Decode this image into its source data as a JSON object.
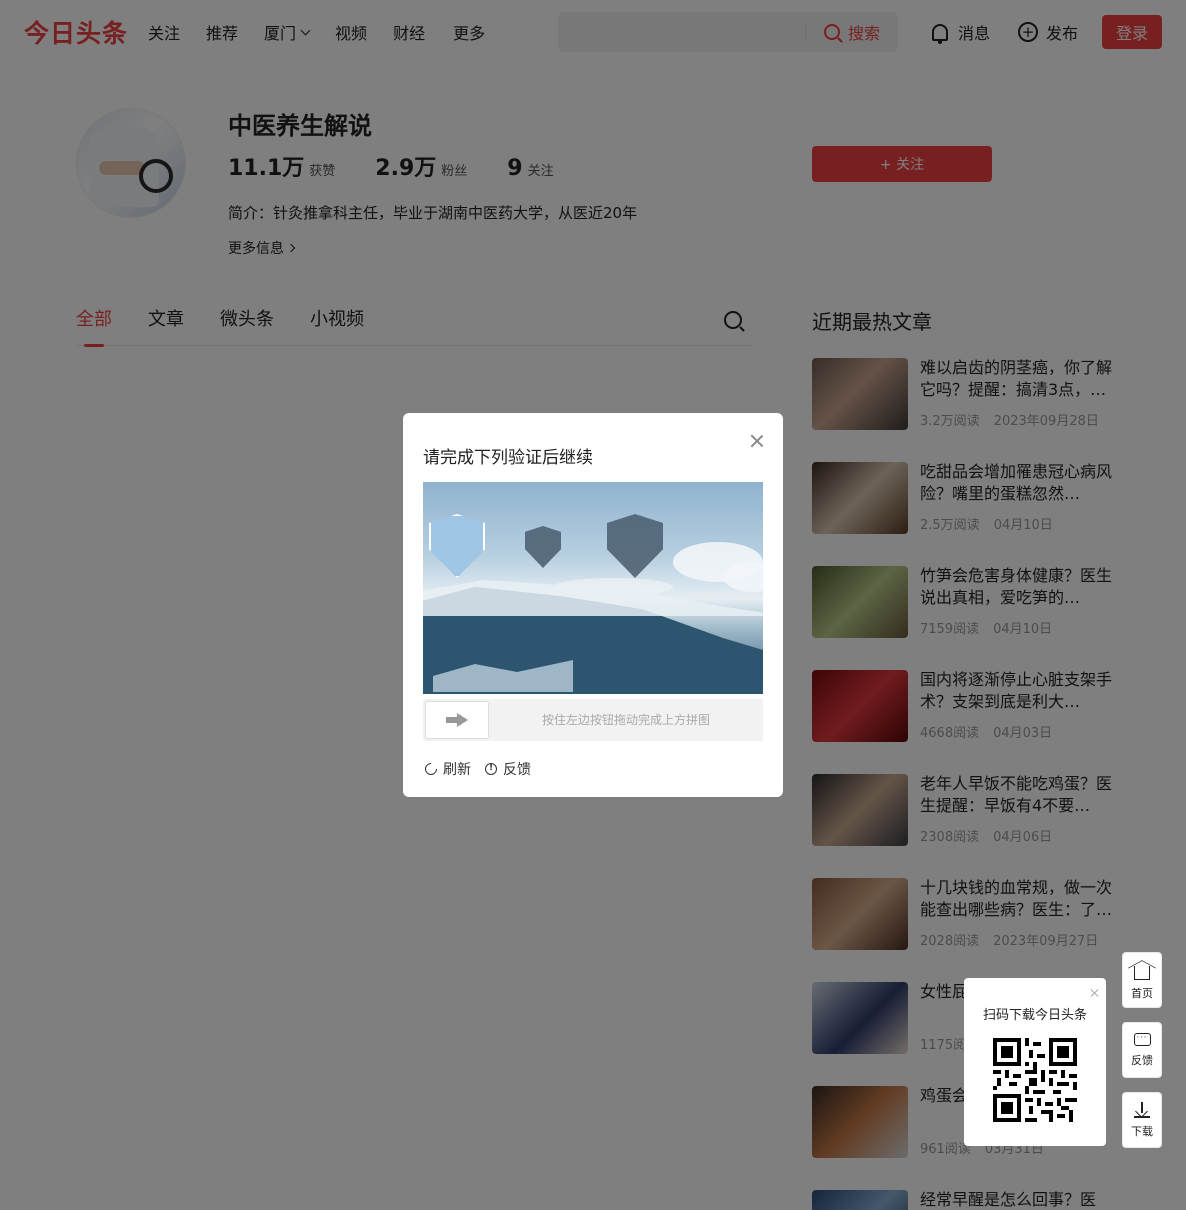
{
  "header": {
    "logo": "今日头条",
    "nav": [
      {
        "label": "关注"
      },
      {
        "label": "推荐"
      },
      {
        "label": "厦门",
        "dropdown": true
      },
      {
        "label": "视频"
      },
      {
        "label": "财经"
      },
      {
        "label": "更多"
      }
    ],
    "search_button": "搜索",
    "messages": "消息",
    "publish": "发布",
    "login": "登录"
  },
  "profile": {
    "name": "中医养生解说",
    "stats": [
      {
        "value": "11.1万",
        "label": "获赞"
      },
      {
        "value": "2.9万",
        "label": "粉丝"
      },
      {
        "value": "9",
        "label": "关注"
      }
    ],
    "follow_button": "+ 关注",
    "bio": "简介：针灸推拿科主任，毕业于湖南中医药大学，从医近20年",
    "more_info": "更多信息"
  },
  "tabs": [
    "全部",
    "文章",
    "微头条",
    "小视频"
  ],
  "hot": {
    "title": "近期最热文章",
    "items": [
      {
        "title": "难以启齿的阴茎癌，你了解它吗？提醒：搞清3点，…",
        "reads": "3.2万阅读",
        "date": "2023年09月28日"
      },
      {
        "title": "吃甜品会增加罹患冠心病风险？嘴里的蛋糕忽然…",
        "reads": "2.5万阅读",
        "date": "04月10日"
      },
      {
        "title": "竹笋会危害身体健康？医生说出真相，爱吃笋的…",
        "reads": "7159阅读",
        "date": "04月10日"
      },
      {
        "title": "国内将逐渐停止心脏支架手术？支架到底是利大…",
        "reads": "4668阅读",
        "date": "04月03日"
      },
      {
        "title": "老年人早饭不能吃鸡蛋？医生提醒：早饭有4不要…",
        "reads": "2308阅读",
        "date": "04月06日"
      },
      {
        "title": "十几块钱的血常规，做一次能查出哪些病？医生：了…",
        "reads": "2028阅读",
        "date": "2023年09月27日"
      },
      {
        "title": "女性屁 常吗？",
        "reads": "1175阅",
        "date": ""
      },
      {
        "title": "鸡蛋会 生坦言",
        "reads": "961阅读",
        "date": "03月31日"
      },
      {
        "title": "经常早醒是怎么回事？医",
        "reads": "",
        "date": ""
      }
    ]
  },
  "captcha": {
    "title": "请完成下列验证后继续",
    "slider_hint": "按住左边按钮拖动完成上方拼图",
    "refresh": "刷新",
    "feedback": "反馈"
  },
  "qr": {
    "title": "扫码下载今日头条"
  },
  "float_tools": [
    {
      "label": "首页",
      "icon": "home-icon"
    },
    {
      "label": "反馈",
      "icon": "message-icon"
    },
    {
      "label": "下载",
      "icon": "download-icon"
    }
  ]
}
